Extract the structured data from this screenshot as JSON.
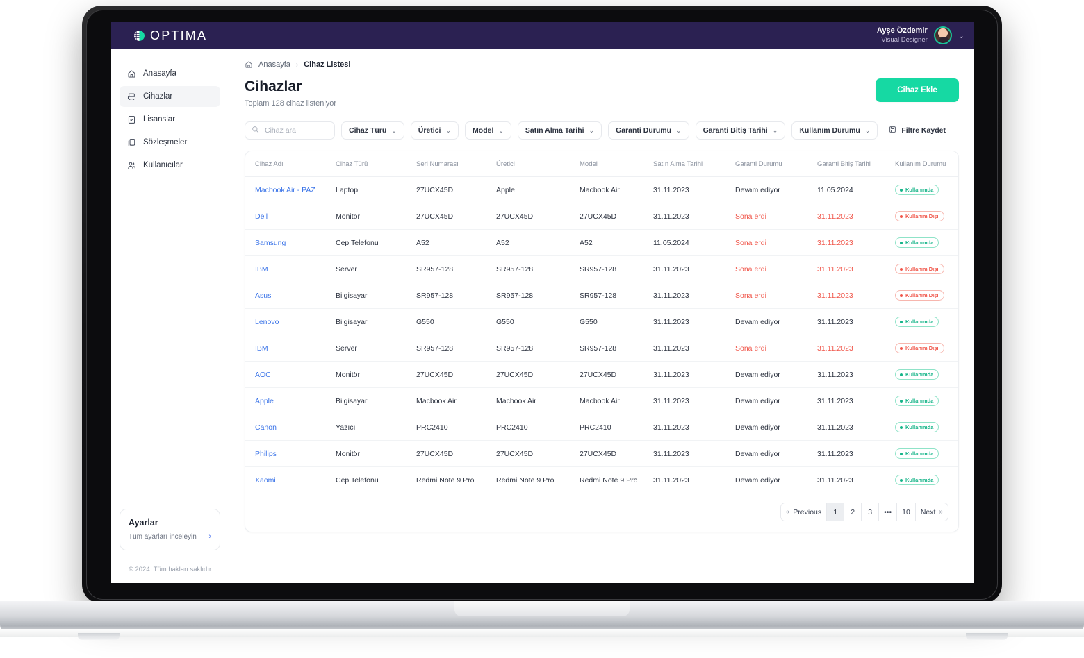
{
  "brand": {
    "name": "OPTIMA",
    "accent": "#16d9a3",
    "topbar_bg": "#2b2152",
    "link": "#3b74e8",
    "danger": "#f0564a"
  },
  "user": {
    "name": "Ayşe Özdemir",
    "role": "Visual Designer",
    "caret": "⌄"
  },
  "sidebar": {
    "items": [
      {
        "label": "Anasayfa",
        "icon": "home-icon",
        "active": false
      },
      {
        "label": "Cihazlar",
        "icon": "device-icon",
        "active": true
      },
      {
        "label": "Lisanslar",
        "icon": "license-icon",
        "active": false
      },
      {
        "label": "Sözleşmeler",
        "icon": "contract-icon",
        "active": false
      },
      {
        "label": "Kullanıcılar",
        "icon": "users-icon",
        "active": false
      }
    ],
    "settings": {
      "title": "Ayarlar",
      "subtitle": "Tüm ayarları inceleyin",
      "arrow": "›"
    },
    "copyright": "© 2024. Tüm hakları saklıdır"
  },
  "breadcrumb": {
    "home": "Anasayfa",
    "separator": "›",
    "current": "Cihaz Listesi"
  },
  "page": {
    "title": "Cihazlar",
    "subtitle": "Toplam 128 cihaz listeniyor",
    "add_button": "Cihaz Ekle"
  },
  "search": {
    "placeholder": "Cihaz ara",
    "value": ""
  },
  "filters": [
    {
      "label": "Cihaz Türü"
    },
    {
      "label": "Üretici"
    },
    {
      "label": "Model"
    },
    {
      "label": "Satın Alma Tarihi"
    },
    {
      "label": "Garanti Durumu"
    },
    {
      "label": "Garanti Bitiş Tarihi"
    },
    {
      "label": "Kullanım Durumu"
    }
  ],
  "save_filter": {
    "label": "Filtre Kaydet",
    "icon": "save-icon"
  },
  "table": {
    "columns": [
      "Cihaz Adı",
      "Cihaz Türü",
      "Seri Numarası",
      "Üretici",
      "Model",
      "Satın Alma Tarihi",
      "Garanti Durumu",
      "Garanti Bitiş Tarihi",
      "Kullanım Durumu"
    ],
    "rows": [
      {
        "name": "Macbook Air - PAZ",
        "type": "Laptop",
        "serial": "27UCX45D",
        "maker": "Apple",
        "model": "Macbook Air",
        "purchase": "31.11.2023",
        "warranty": "Devam ediyor",
        "warranty_expired": false,
        "warranty_end": "11.05.2024",
        "end_expired": false,
        "usage": "Kullanımda",
        "usage_active": true
      },
      {
        "name": "Dell",
        "type": "Monitör",
        "serial": "27UCX45D",
        "maker": "27UCX45D",
        "model": "27UCX45D",
        "purchase": "31.11.2023",
        "warranty": "Sona erdi",
        "warranty_expired": true,
        "warranty_end": "31.11.2023",
        "end_expired": true,
        "usage": "Kullanım Dışı",
        "usage_active": false
      },
      {
        "name": "Samsung",
        "type": "Cep Telefonu",
        "serial": "A52",
        "maker": "A52",
        "model": "A52",
        "purchase": "11.05.2024",
        "warranty": "Sona erdi",
        "warranty_expired": true,
        "warranty_end": "31.11.2023",
        "end_expired": true,
        "usage": "Kullanımda",
        "usage_active": true
      },
      {
        "name": "IBM",
        "type": "Server",
        "serial": "SR957-128",
        "maker": "SR957-128",
        "model": "SR957-128",
        "purchase": "31.11.2023",
        "warranty": "Sona erdi",
        "warranty_expired": true,
        "warranty_end": "31.11.2023",
        "end_expired": true,
        "usage": "Kullanım Dışı",
        "usage_active": false
      },
      {
        "name": "Asus",
        "type": "Bilgisayar",
        "serial": "SR957-128",
        "maker": "SR957-128",
        "model": "SR957-128",
        "purchase": "31.11.2023",
        "warranty": "Sona erdi",
        "warranty_expired": true,
        "warranty_end": "31.11.2023",
        "end_expired": true,
        "usage": "Kullanım Dışı",
        "usage_active": false
      },
      {
        "name": "Lenovo",
        "type": "Bilgisayar",
        "serial": "G550",
        "maker": "G550",
        "model": "G550",
        "purchase": "31.11.2023",
        "warranty": "Devam ediyor",
        "warranty_expired": false,
        "warranty_end": "31.11.2023",
        "end_expired": false,
        "usage": "Kullanımda",
        "usage_active": true
      },
      {
        "name": "IBM",
        "type": "Server",
        "serial": "SR957-128",
        "maker": "SR957-128",
        "model": "SR957-128",
        "purchase": "31.11.2023",
        "warranty": "Sona erdi",
        "warranty_expired": true,
        "warranty_end": "31.11.2023",
        "end_expired": true,
        "usage": "Kullanım Dışı",
        "usage_active": false
      },
      {
        "name": "AOC",
        "type": "Monitör",
        "serial": "27UCX45D",
        "maker": "27UCX45D",
        "model": "27UCX45D",
        "purchase": "31.11.2023",
        "warranty": "Devam ediyor",
        "warranty_expired": false,
        "warranty_end": "31.11.2023",
        "end_expired": false,
        "usage": "Kullanımda",
        "usage_active": true
      },
      {
        "name": "Apple",
        "type": "Bilgisayar",
        "serial": "Macbook Air",
        "maker": "Macbook Air",
        "model": "Macbook Air",
        "purchase": "31.11.2023",
        "warranty": "Devam ediyor",
        "warranty_expired": false,
        "warranty_end": "31.11.2023",
        "end_expired": false,
        "usage": "Kullanımda",
        "usage_active": true
      },
      {
        "name": "Canon",
        "type": "Yazıcı",
        "serial": "PRC2410",
        "maker": "PRC2410",
        "model": "PRC2410",
        "purchase": "31.11.2023",
        "warranty": "Devam ediyor",
        "warranty_expired": false,
        "warranty_end": "31.11.2023",
        "end_expired": false,
        "usage": "Kullanımda",
        "usage_active": true
      },
      {
        "name": "Philips",
        "type": "Monitör",
        "serial": "27UCX45D",
        "maker": "27UCX45D",
        "model": "27UCX45D",
        "purchase": "31.11.2023",
        "warranty": "Devam ediyor",
        "warranty_expired": false,
        "warranty_end": "31.11.2023",
        "end_expired": false,
        "usage": "Kullanımda",
        "usage_active": true
      },
      {
        "name": "Xaomi",
        "type": "Cep Telefonu",
        "serial": "Redmi Note 9 Pro",
        "maker": "Redmi Note 9 Pro",
        "model": "Redmi Note 9 Pro",
        "purchase": "31.11.2023",
        "warranty": "Devam ediyor",
        "warranty_expired": false,
        "warranty_end": "31.11.2023",
        "end_expired": false,
        "usage": "Kullanımda",
        "usage_active": true
      }
    ]
  },
  "pagination": {
    "previous": "Previous",
    "prev_chevron": "«",
    "next": "Next",
    "next_chevron": "»",
    "pages": [
      "1",
      "2",
      "3",
      "•••",
      "10"
    ],
    "active_page": "1"
  }
}
